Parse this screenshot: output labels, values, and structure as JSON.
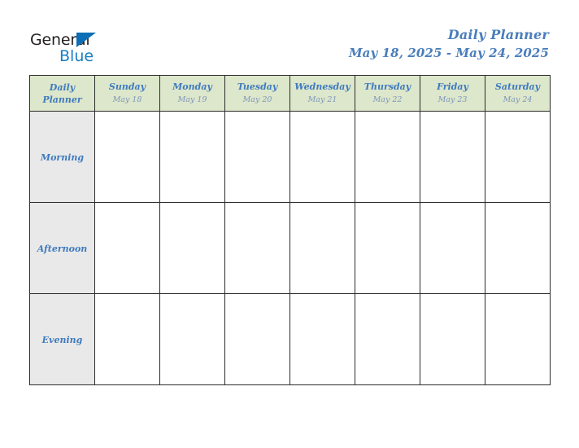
{
  "brand": {
    "name_part1": "General",
    "name_part2": "Blue",
    "triangle_color": "#0c6eb5",
    "blue_color": "#1a7ec4",
    "dark_color": "#231f20"
  },
  "header": {
    "title": "Daily Planner",
    "date_range": "May 18, 2025 - May 24, 2025",
    "title_color": "#4a7ebb"
  },
  "table": {
    "corner_label": "Daily Planner",
    "header_bg": "#dde7cb",
    "row_label_bg": "#e9e9e9",
    "accent_text_color": "#3f7bbf",
    "date_text_color": "#7e96bb",
    "border_color": "#2b2b2b",
    "columns": [
      {
        "day": "Sunday",
        "date": "May 18"
      },
      {
        "day": "Monday",
        "date": "May 19"
      },
      {
        "day": "Tuesday",
        "date": "May 20"
      },
      {
        "day": "Wednesday",
        "date": "May 21"
      },
      {
        "day": "Thursday",
        "date": "May 22"
      },
      {
        "day": "Friday",
        "date": "May 23"
      },
      {
        "day": "Saturday",
        "date": "May 24"
      }
    ],
    "rows": [
      {
        "label": "Morning",
        "cells": [
          "",
          "",
          "",
          "",
          "",
          "",
          ""
        ]
      },
      {
        "label": "Afternoon",
        "cells": [
          "",
          "",
          "",
          "",
          "",
          "",
          ""
        ]
      },
      {
        "label": "Evening",
        "cells": [
          "",
          "",
          "",
          "",
          "",
          "",
          ""
        ]
      }
    ]
  }
}
